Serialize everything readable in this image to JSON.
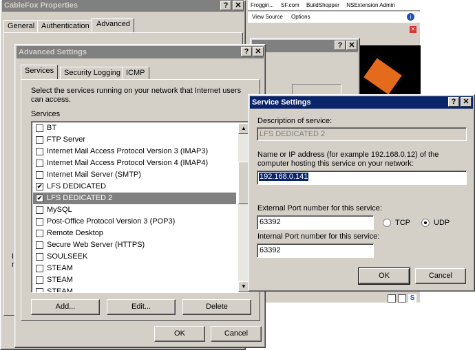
{
  "cablefox": {
    "title": "CableFox Properties",
    "tabs": [
      "General",
      "Authentication",
      "Advanced"
    ],
    "side_labels": [
      "I",
      "n"
    ]
  },
  "bg_window": {
    "toolbar_items": [
      "Froggin...",
      "SF.com",
      "BuildShopper",
      "NSExtension Admin"
    ],
    "row2_items": [
      "View Source",
      "Options"
    ]
  },
  "advanced": {
    "title": "Advanced Settings",
    "tabs": [
      "Services",
      "Security Logging",
      "ICMP"
    ],
    "description": "Select the services running on your network that Internet users can access.",
    "services_label": "Services",
    "services": [
      {
        "label": "BT",
        "checked": false
      },
      {
        "label": "FTP Server",
        "checked": false
      },
      {
        "label": "Internet Mail Access Protocol Version 3 (IMAP3)",
        "checked": false
      },
      {
        "label": "Internet Mail Access Protocol Version 4 (IMAP4)",
        "checked": false
      },
      {
        "label": "Internet Mail Server (SMTP)",
        "checked": false
      },
      {
        "label": "LFS DEDICATED",
        "checked": true
      },
      {
        "label": "LFS DEDICATED 2",
        "checked": true
      },
      {
        "label": "MySQL",
        "checked": false
      },
      {
        "label": "Post-Office Protocol Version 3 (POP3)",
        "checked": false
      },
      {
        "label": "Remote Desktop",
        "checked": false
      },
      {
        "label": "Secure Web Server (HTTPS)",
        "checked": false
      },
      {
        "label": "SOULSEEK",
        "checked": false
      },
      {
        "label": "STEAM",
        "checked": false
      },
      {
        "label": "STEAM",
        "checked": false
      },
      {
        "label": "STEAM",
        "checked": false
      }
    ],
    "selected_index": 6,
    "buttons": {
      "add": "Add...",
      "edit": "Edit...",
      "delete": "Delete",
      "ok": "OK",
      "cancel": "Cancel"
    }
  },
  "service": {
    "title": "Service Settings",
    "desc_label": "Description of service:",
    "desc_value": "LFS DEDICATED 2",
    "ip_label": "Name or IP address (for example 192.168.0.12) of the computer hosting this service on your network:",
    "ip_value": "192.168.0.141",
    "ext_label": "External Port number for this service:",
    "ext_value": "63392",
    "int_label": "Internal Port number for this service:",
    "int_value": "63392",
    "tcp_label": "TCP",
    "udp_label": "UDP",
    "protocol": "UDP",
    "ok": "OK",
    "cancel": "Cancel"
  },
  "caption_buttons": {
    "help": "?",
    "close": "✕"
  }
}
